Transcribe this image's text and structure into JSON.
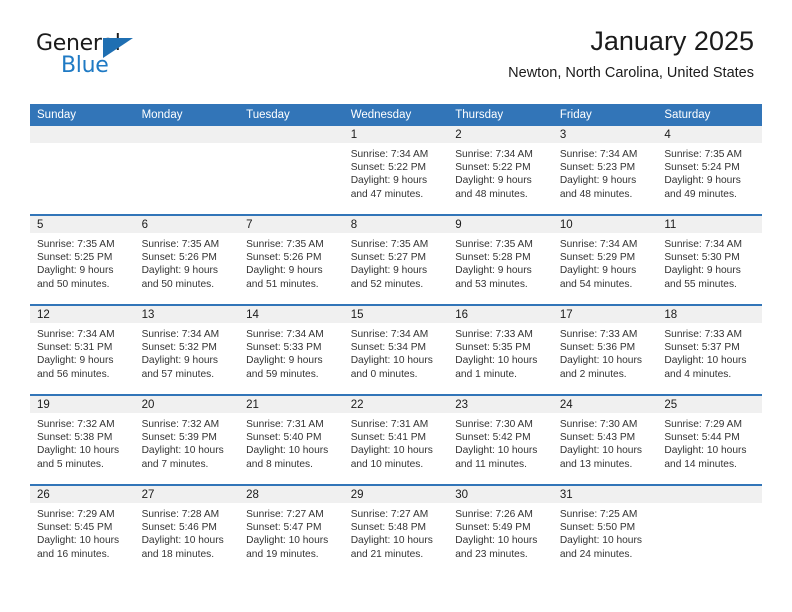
{
  "brand": {
    "name_top": "General",
    "name_bottom": "Blue",
    "triangle_color": "#1f6fb2",
    "blue_text_color": "#1f7ac4"
  },
  "header": {
    "title": "January 2025",
    "location": "Newton, North Carolina, United States"
  },
  "theme": {
    "header_blue": "#3275b8",
    "daynum_band_gray": "#f0f0f0",
    "text_color": "#333333"
  },
  "weekday_headers": [
    "Sunday",
    "Monday",
    "Tuesday",
    "Wednesday",
    "Thursday",
    "Friday",
    "Saturday"
  ],
  "weeks": [
    [
      {
        "day": "",
        "sunrise": "",
        "sunset": "",
        "daylight_line1": "",
        "daylight_line2": ""
      },
      {
        "day": "",
        "sunrise": "",
        "sunset": "",
        "daylight_line1": "",
        "daylight_line2": ""
      },
      {
        "day": "",
        "sunrise": "",
        "sunset": "",
        "daylight_line1": "",
        "daylight_line2": ""
      },
      {
        "day": "1",
        "sunrise": "Sunrise: 7:34 AM",
        "sunset": "Sunset: 5:22 PM",
        "daylight_line1": "Daylight: 9 hours",
        "daylight_line2": "and 47 minutes."
      },
      {
        "day": "2",
        "sunrise": "Sunrise: 7:34 AM",
        "sunset": "Sunset: 5:22 PM",
        "daylight_line1": "Daylight: 9 hours",
        "daylight_line2": "and 48 minutes."
      },
      {
        "day": "3",
        "sunrise": "Sunrise: 7:34 AM",
        "sunset": "Sunset: 5:23 PM",
        "daylight_line1": "Daylight: 9 hours",
        "daylight_line2": "and 48 minutes."
      },
      {
        "day": "4",
        "sunrise": "Sunrise: 7:35 AM",
        "sunset": "Sunset: 5:24 PM",
        "daylight_line1": "Daylight: 9 hours",
        "daylight_line2": "and 49 minutes."
      }
    ],
    [
      {
        "day": "5",
        "sunrise": "Sunrise: 7:35 AM",
        "sunset": "Sunset: 5:25 PM",
        "daylight_line1": "Daylight: 9 hours",
        "daylight_line2": "and 50 minutes."
      },
      {
        "day": "6",
        "sunrise": "Sunrise: 7:35 AM",
        "sunset": "Sunset: 5:26 PM",
        "daylight_line1": "Daylight: 9 hours",
        "daylight_line2": "and 50 minutes."
      },
      {
        "day": "7",
        "sunrise": "Sunrise: 7:35 AM",
        "sunset": "Sunset: 5:26 PM",
        "daylight_line1": "Daylight: 9 hours",
        "daylight_line2": "and 51 minutes."
      },
      {
        "day": "8",
        "sunrise": "Sunrise: 7:35 AM",
        "sunset": "Sunset: 5:27 PM",
        "daylight_line1": "Daylight: 9 hours",
        "daylight_line2": "and 52 minutes."
      },
      {
        "day": "9",
        "sunrise": "Sunrise: 7:35 AM",
        "sunset": "Sunset: 5:28 PM",
        "daylight_line1": "Daylight: 9 hours",
        "daylight_line2": "and 53 minutes."
      },
      {
        "day": "10",
        "sunrise": "Sunrise: 7:34 AM",
        "sunset": "Sunset: 5:29 PM",
        "daylight_line1": "Daylight: 9 hours",
        "daylight_line2": "and 54 minutes."
      },
      {
        "day": "11",
        "sunrise": "Sunrise: 7:34 AM",
        "sunset": "Sunset: 5:30 PM",
        "daylight_line1": "Daylight: 9 hours",
        "daylight_line2": "and 55 minutes."
      }
    ],
    [
      {
        "day": "12",
        "sunrise": "Sunrise: 7:34 AM",
        "sunset": "Sunset: 5:31 PM",
        "daylight_line1": "Daylight: 9 hours",
        "daylight_line2": "and 56 minutes."
      },
      {
        "day": "13",
        "sunrise": "Sunrise: 7:34 AM",
        "sunset": "Sunset: 5:32 PM",
        "daylight_line1": "Daylight: 9 hours",
        "daylight_line2": "and 57 minutes."
      },
      {
        "day": "14",
        "sunrise": "Sunrise: 7:34 AM",
        "sunset": "Sunset: 5:33 PM",
        "daylight_line1": "Daylight: 9 hours",
        "daylight_line2": "and 59 minutes."
      },
      {
        "day": "15",
        "sunrise": "Sunrise: 7:34 AM",
        "sunset": "Sunset: 5:34 PM",
        "daylight_line1": "Daylight: 10 hours",
        "daylight_line2": "and 0 minutes."
      },
      {
        "day": "16",
        "sunrise": "Sunrise: 7:33 AM",
        "sunset": "Sunset: 5:35 PM",
        "daylight_line1": "Daylight: 10 hours",
        "daylight_line2": "and 1 minute."
      },
      {
        "day": "17",
        "sunrise": "Sunrise: 7:33 AM",
        "sunset": "Sunset: 5:36 PM",
        "daylight_line1": "Daylight: 10 hours",
        "daylight_line2": "and 2 minutes."
      },
      {
        "day": "18",
        "sunrise": "Sunrise: 7:33 AM",
        "sunset": "Sunset: 5:37 PM",
        "daylight_line1": "Daylight: 10 hours",
        "daylight_line2": "and 4 minutes."
      }
    ],
    [
      {
        "day": "19",
        "sunrise": "Sunrise: 7:32 AM",
        "sunset": "Sunset: 5:38 PM",
        "daylight_line1": "Daylight: 10 hours",
        "daylight_line2": "and 5 minutes."
      },
      {
        "day": "20",
        "sunrise": "Sunrise: 7:32 AM",
        "sunset": "Sunset: 5:39 PM",
        "daylight_line1": "Daylight: 10 hours",
        "daylight_line2": "and 7 minutes."
      },
      {
        "day": "21",
        "sunrise": "Sunrise: 7:31 AM",
        "sunset": "Sunset: 5:40 PM",
        "daylight_line1": "Daylight: 10 hours",
        "daylight_line2": "and 8 minutes."
      },
      {
        "day": "22",
        "sunrise": "Sunrise: 7:31 AM",
        "sunset": "Sunset: 5:41 PM",
        "daylight_line1": "Daylight: 10 hours",
        "daylight_line2": "and 10 minutes."
      },
      {
        "day": "23",
        "sunrise": "Sunrise: 7:30 AM",
        "sunset": "Sunset: 5:42 PM",
        "daylight_line1": "Daylight: 10 hours",
        "daylight_line2": "and 11 minutes."
      },
      {
        "day": "24",
        "sunrise": "Sunrise: 7:30 AM",
        "sunset": "Sunset: 5:43 PM",
        "daylight_line1": "Daylight: 10 hours",
        "daylight_line2": "and 13 minutes."
      },
      {
        "day": "25",
        "sunrise": "Sunrise: 7:29 AM",
        "sunset": "Sunset: 5:44 PM",
        "daylight_line1": "Daylight: 10 hours",
        "daylight_line2": "and 14 minutes."
      }
    ],
    [
      {
        "day": "26",
        "sunrise": "Sunrise: 7:29 AM",
        "sunset": "Sunset: 5:45 PM",
        "daylight_line1": "Daylight: 10 hours",
        "daylight_line2": "and 16 minutes."
      },
      {
        "day": "27",
        "sunrise": "Sunrise: 7:28 AM",
        "sunset": "Sunset: 5:46 PM",
        "daylight_line1": "Daylight: 10 hours",
        "daylight_line2": "and 18 minutes."
      },
      {
        "day": "28",
        "sunrise": "Sunrise: 7:27 AM",
        "sunset": "Sunset: 5:47 PM",
        "daylight_line1": "Daylight: 10 hours",
        "daylight_line2": "and 19 minutes."
      },
      {
        "day": "29",
        "sunrise": "Sunrise: 7:27 AM",
        "sunset": "Sunset: 5:48 PM",
        "daylight_line1": "Daylight: 10 hours",
        "daylight_line2": "and 21 minutes."
      },
      {
        "day": "30",
        "sunrise": "Sunrise: 7:26 AM",
        "sunset": "Sunset: 5:49 PM",
        "daylight_line1": "Daylight: 10 hours",
        "daylight_line2": "and 23 minutes."
      },
      {
        "day": "31",
        "sunrise": "Sunrise: 7:25 AM",
        "sunset": "Sunset: 5:50 PM",
        "daylight_line1": "Daylight: 10 hours",
        "daylight_line2": "and 24 minutes."
      },
      {
        "day": "",
        "sunrise": "",
        "sunset": "",
        "daylight_line1": "",
        "daylight_line2": ""
      }
    ]
  ]
}
